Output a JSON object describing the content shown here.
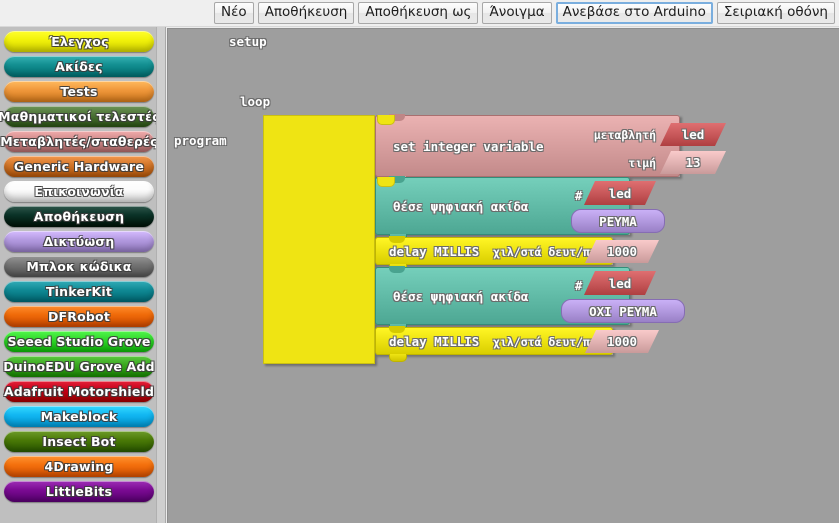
{
  "toolbar": {
    "buttons": [
      {
        "label": "Νέο",
        "name": "new-button",
        "focused": false
      },
      {
        "label": "Αποθήκευση",
        "name": "save-button",
        "focused": false
      },
      {
        "label": "Αποθήκευση ως",
        "name": "save-as-button",
        "focused": false
      },
      {
        "label": "Άνοιγμα",
        "name": "open-button",
        "focused": false
      },
      {
        "label": "Ανεβάσε στο Arduino",
        "name": "upload-to-arduino-button",
        "focused": true
      },
      {
        "label": "Σειριακή οθόνη",
        "name": "serial-monitor-button",
        "focused": false
      }
    ]
  },
  "sidebar": {
    "items": [
      {
        "label": "Έλεγχος",
        "name": "sidebar-item-control",
        "color": "#f2f20a",
        "text_color": "#ffffff"
      },
      {
        "label": "Ακίδες",
        "name": "sidebar-item-pins",
        "color": "#138f91",
        "text_color": "#ffffff"
      },
      {
        "label": "Tests",
        "name": "sidebar-item-tests",
        "color": "#f0983c",
        "text_color": "#ffffff"
      },
      {
        "label": "Μαθηματικοί τελεστές",
        "name": "sidebar-item-math-operators",
        "color": "#4c7336",
        "text_color": "#ffffff"
      },
      {
        "label": "Μεταβλητές/σταθερές",
        "name": "sidebar-item-variables-constants",
        "color": "#cf8a8a",
        "text_color": "#ffffff"
      },
      {
        "label": "Generic Hardware",
        "name": "sidebar-item-generic-hardware",
        "color": "#d2762a",
        "text_color": "#ffffff"
      },
      {
        "label": "Επικοινωνία",
        "name": "sidebar-item-communication",
        "color": "#fbfbfb",
        "text_color": "#ffffff"
      },
      {
        "label": "Αποθήκευση",
        "name": "sidebar-item-storage",
        "color": "#0b3328",
        "text_color": "#ffffff"
      },
      {
        "label": "Δικτύωση",
        "name": "sidebar-item-networking",
        "color": "#b39ae0",
        "text_color": "#ffffff"
      },
      {
        "label": "Μπλοκ κώδικα",
        "name": "sidebar-item-code-blocks",
        "color": "#737373",
        "text_color": "#ffffff"
      },
      {
        "label": "TinkerKit",
        "name": "sidebar-item-tinkerkit",
        "color": "#108a95",
        "text_color": "#ffffff"
      },
      {
        "label": "DFRobot",
        "name": "sidebar-item-dfrobot",
        "color": "#ef6a09",
        "text_color": "#ffffff"
      },
      {
        "label": "Seeed Studio Grove",
        "name": "sidebar-item-seeed-studio-grove",
        "color": "#30d62a",
        "text_color": "#ffffff"
      },
      {
        "label": "DuinoEDU Grove Add",
        "name": "sidebar-item-duinoedu-grove-add",
        "color": "#3aa81f",
        "text_color": "#ffffff"
      },
      {
        "label": "Adafruit Motorshield",
        "name": "sidebar-item-adafruit-motorshield",
        "color": "#c30018",
        "text_color": "#ffffff"
      },
      {
        "label": "Makeblock",
        "name": "sidebar-item-makeblock",
        "color": "#12b7f2",
        "text_color": "#ffffff"
      },
      {
        "label": "Insect Bot",
        "name": "sidebar-item-insect-bot",
        "color": "#4b7a07",
        "text_color": "#ffffff"
      },
      {
        "label": "4Drawing",
        "name": "sidebar-item-4drawing",
        "color": "#f4700d",
        "text_color": "#ffffff"
      },
      {
        "label": "LittleBits",
        "name": "sidebar-item-littlebits",
        "color": "#7b0b93",
        "text_color": "#ffffff"
      }
    ]
  },
  "canvas": {
    "background": "#9e9e9e",
    "program": {
      "label": "program",
      "color": "#efe413",
      "setup_socket_label": "setup",
      "loop_socket_label": "loop"
    },
    "setup_stack": [
      {
        "name": "set-integer-variable-block",
        "color": "#d9a0a0",
        "text": "set integer variable",
        "args": [
          {
            "label": "μεταβλητή",
            "value": "led",
            "shape": "hex",
            "color": "#c9595b"
          },
          {
            "label": "τιμή",
            "value": "13",
            "shape": "hex",
            "color": "#e3b4b4"
          }
        ]
      }
    ],
    "loop_stack": [
      {
        "name": "set-digital-pin-block",
        "color": "#63bda9",
        "text": "θέσε ψηφιακή ακίδα",
        "hash": "#",
        "args": [
          {
            "label": "",
            "value": "led",
            "shape": "hex",
            "color": "#c9595b"
          },
          {
            "label": "",
            "value": "ΡΕΥΜΑ",
            "shape": "oval",
            "color": "#b39ae0"
          }
        ]
      },
      {
        "name": "delay-millis-block",
        "color": "#efe413",
        "text": "delay MILLIS",
        "args": [
          {
            "label": "χιλ/στά δευτ/πτου",
            "value": "1000",
            "shape": "hex",
            "color": "#e3b4b4"
          }
        ]
      },
      {
        "name": "set-digital-pin-block",
        "color": "#63bda9",
        "text": "θέσε ψηφιακή ακίδα",
        "hash": "#",
        "args": [
          {
            "label": "",
            "value": "led",
            "shape": "hex",
            "color": "#c9595b"
          },
          {
            "label": "",
            "value": "ΟΧΙ ΡΕΥΜΑ",
            "shape": "oval",
            "color": "#b39ae0"
          }
        ]
      },
      {
        "name": "delay-millis-block",
        "color": "#efe413",
        "text": "delay MILLIS",
        "args": [
          {
            "label": "χιλ/στά δευτ/πτου",
            "value": "1000",
            "shape": "hex",
            "color": "#e3b4b4"
          }
        ]
      }
    ]
  }
}
